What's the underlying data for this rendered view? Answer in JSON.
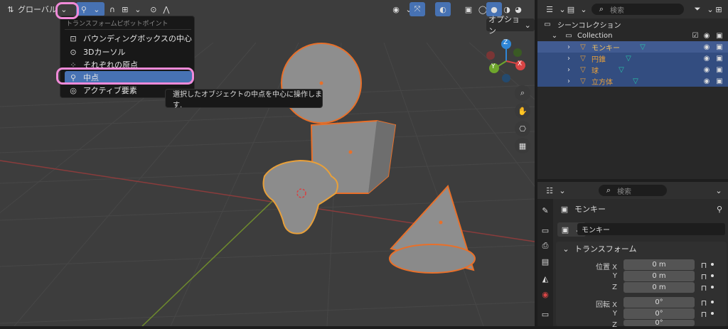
{
  "viewport": {
    "orientation_label": "グローバル",
    "options_label": "オプション"
  },
  "pivot_menu": {
    "title": "トランスフォームピボットポイント",
    "items": [
      {
        "label": "バウンディングボックスの中心"
      },
      {
        "label": "3Dカーソル"
      },
      {
        "label": "それぞれの原点"
      },
      {
        "label": "中点"
      },
      {
        "label": "アクティブ要素"
      }
    ],
    "selected_index": 3
  },
  "tooltip": {
    "text": "選択したオブジェクトの中点を中心に操作します."
  },
  "gizmo": {
    "z": "Z",
    "y": "Y",
    "x": "X"
  },
  "outliner": {
    "search_placeholder": "検索",
    "scene_collection": "シーンコレクション",
    "collection": "Collection",
    "objects": [
      {
        "name": "モンキー"
      },
      {
        "name": "円錐"
      },
      {
        "name": "球"
      },
      {
        "name": "立方体"
      }
    ]
  },
  "properties": {
    "search_placeholder": "検索",
    "object_name": "モンキー",
    "object_field": "モンキー",
    "section_transform": "トランスフォーム",
    "location_label": "位置 X",
    "rotation_label": "回転 X",
    "axis_y": "Y",
    "axis_z": "Z",
    "location": {
      "x": "0 m",
      "y": "0 m",
      "z": "0 m"
    },
    "rotation": {
      "x": "0°",
      "y": "0°",
      "z": "0°"
    }
  },
  "colors": {
    "accent": "#4772b3",
    "selection_highlight": "#f08ad8",
    "object_outline": "#e8702a"
  }
}
